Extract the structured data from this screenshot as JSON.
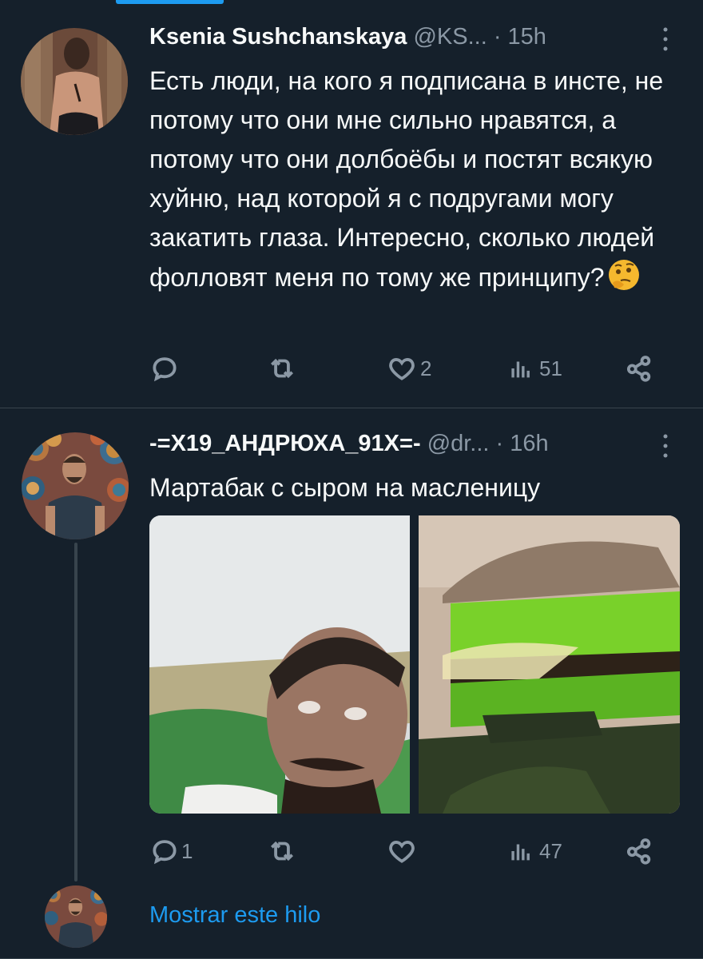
{
  "tweets": [
    {
      "name": "Ksenia Sushchanskaya",
      "handle": "@KS...",
      "separator": "·",
      "time": "15h",
      "text": "Есть люди, на кого я подписана в инсте, не потому что они мне сильно нравятся, а потому что они долбоёбы и постят всякую хуйню, над которой я с подругами могу закатить глаза. Интересно, сколько людей фолловят меня по тому же принципу?",
      "emoji": "thinking-face-emoji",
      "stats": {
        "replies": "",
        "retweets": "",
        "likes": "2",
        "views": "51"
      }
    },
    {
      "name": "-=X19_АНДРЮХА_91X=-",
      "handle": "@dr...",
      "separator": "·",
      "time": "16h",
      "text": "Мартабак с сыром на масленицу",
      "stats": {
        "replies": "1",
        "retweets": "",
        "likes": "",
        "views": "47"
      }
    }
  ],
  "show_thread_label": "Mostrar este hilo",
  "colors": {
    "background": "#15202b",
    "text": "#f7f9f9",
    "secondary": "#8b98a5",
    "accent": "#1d9bf0",
    "divider": "#38444d"
  },
  "icons": [
    "reply-icon",
    "retweet-icon",
    "like-icon",
    "views-icon",
    "share-icon",
    "more-icon"
  ]
}
